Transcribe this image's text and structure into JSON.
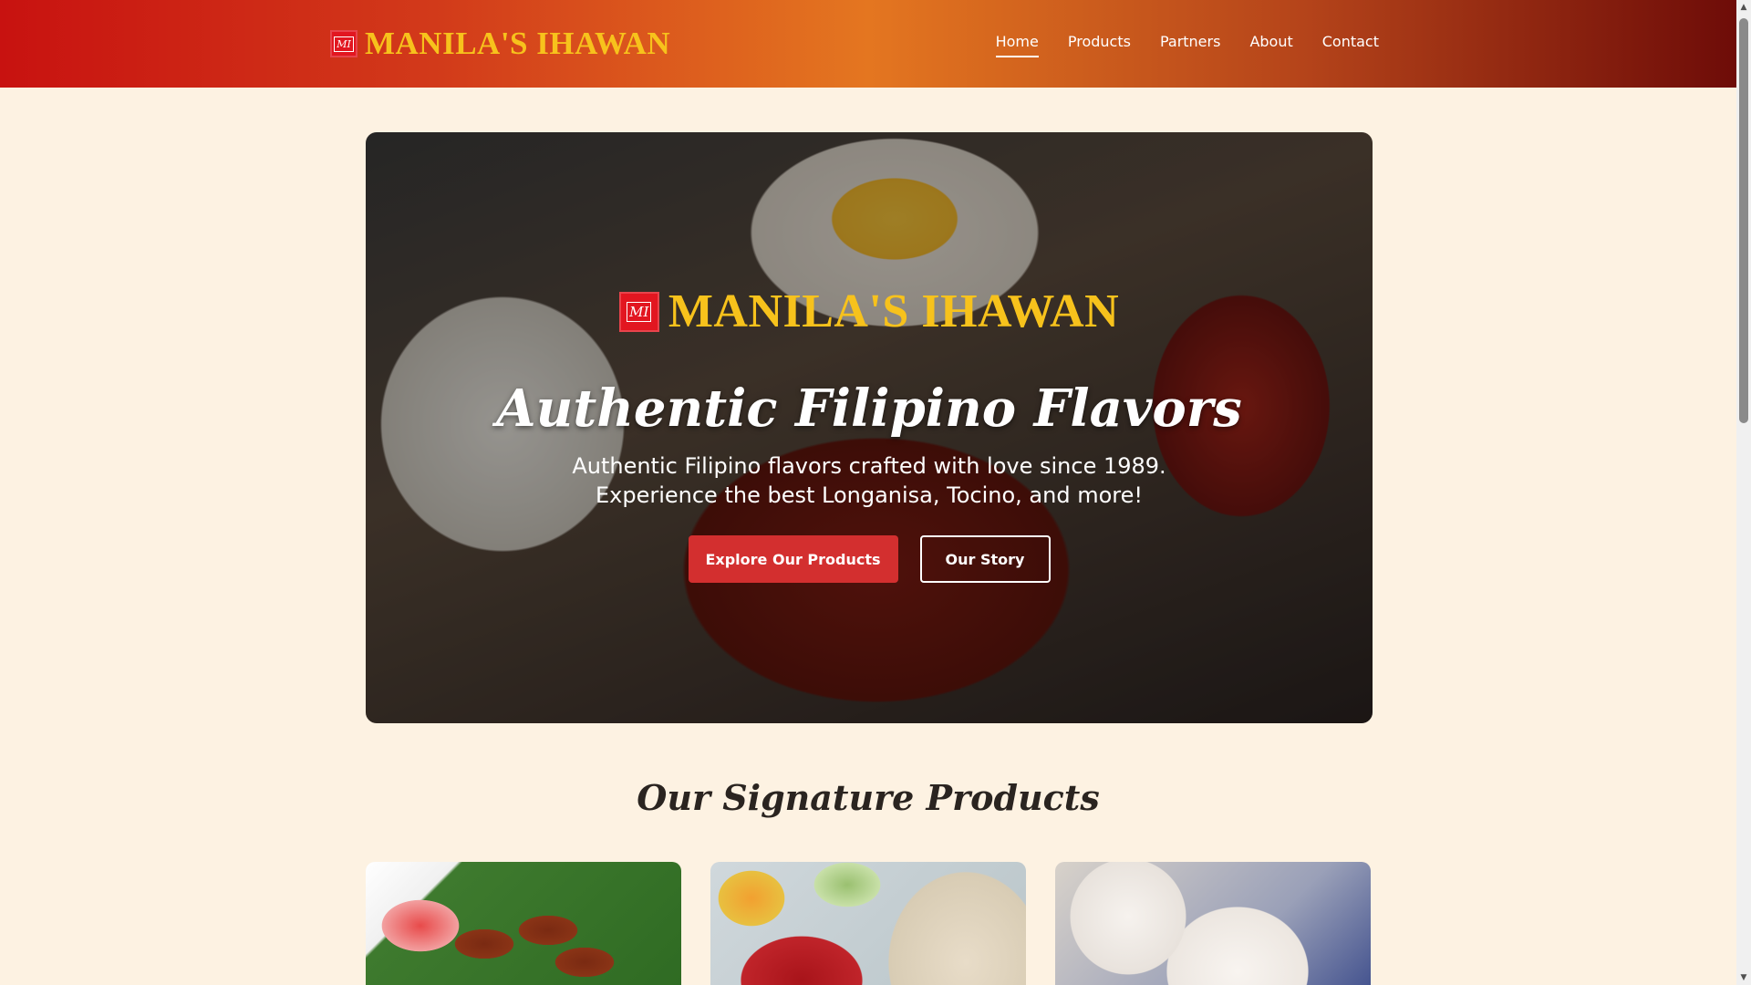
{
  "header": {
    "brand_name": "MANILA'S IHAWAN",
    "logo_monogram": "MI",
    "nav": [
      {
        "label": "Home",
        "active": true
      },
      {
        "label": "Products",
        "active": false
      },
      {
        "label": "Partners",
        "active": false
      },
      {
        "label": "About",
        "active": false
      },
      {
        "label": "Contact",
        "active": false
      }
    ]
  },
  "hero": {
    "brand_name": "MANILA'S IHAWAN",
    "title": "Authentic Filipino Flavors",
    "subtitle_line1": "Authentic Filipino flavors crafted with love since 1989.",
    "subtitle_line2": "Experience the best Longanisa, Tocino, and more!",
    "primary_button": "Explore Our Products",
    "secondary_button": "Our Story"
  },
  "products": {
    "section_title": "Our Signature Products"
  },
  "colors": {
    "brand_yellow": "#f7c21c",
    "primary_red": "#d32f2f",
    "page_background": "#fdf2e2",
    "logo_red": "#e21620"
  },
  "icons": {
    "scroll_up": "triangle-up-icon",
    "scroll_down": "triangle-down-icon"
  }
}
